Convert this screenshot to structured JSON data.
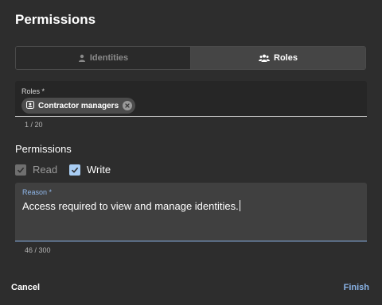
{
  "dialog": {
    "title": "Permissions"
  },
  "mode_toggle": {
    "options": [
      {
        "label": "Identities",
        "icon": "person-icon",
        "selected": false
      },
      {
        "label": "Roles",
        "icon": "group-icon",
        "selected": true
      }
    ]
  },
  "roles_field": {
    "label": "Roles *",
    "chips": [
      {
        "label": "Contractor managers",
        "icon": "role-badge-icon"
      }
    ],
    "counter": "1 / 20"
  },
  "permissions": {
    "heading": "Permissions",
    "read": {
      "label": "Read",
      "checked": true,
      "disabled": true
    },
    "write": {
      "label": "Write",
      "checked": true,
      "disabled": false
    }
  },
  "reason_field": {
    "label": "Reason *",
    "value": "Access required to view and manage identities.",
    "counter": "46 / 300"
  },
  "actions": {
    "cancel": "Cancel",
    "finish": "Finish"
  },
  "colors": {
    "accent": "#8ab4e8",
    "background": "#2d2d2d",
    "field": "#404040"
  }
}
